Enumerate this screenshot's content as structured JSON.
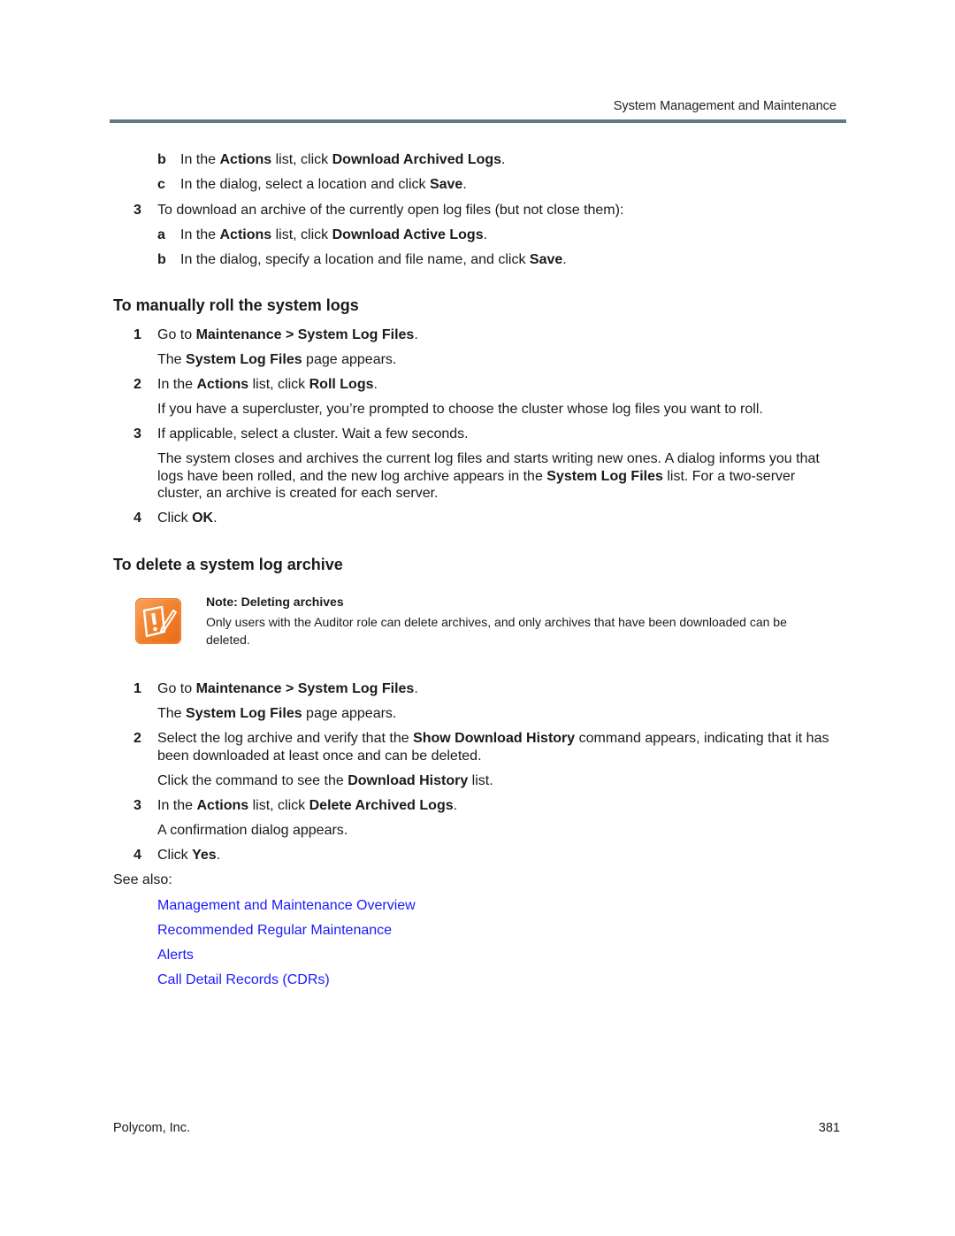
{
  "header": {
    "running_title": "System Management and Maintenance"
  },
  "top_steps": {
    "b1": {
      "marker": "b",
      "pre": "In the ",
      "b1": "Actions",
      "mid": " list, click ",
      "b2": "Download Archived Logs",
      "post": "."
    },
    "c1": {
      "marker": "c",
      "pre": "In the dialog, select a location and click ",
      "b1": "Save",
      "post": "."
    },
    "s3": {
      "marker": "3",
      "text": "To download an archive of the currently open log files (but not close them):"
    },
    "a2": {
      "marker": "a",
      "pre": "In the ",
      "b1": "Actions",
      "mid": " list, click ",
      "b2": "Download Active Logs",
      "post": "."
    },
    "b2": {
      "marker": "b",
      "pre": "In the dialog, specify a location and file name, and click ",
      "b1": "Save",
      "post": "."
    }
  },
  "roll_section": {
    "heading": "To manually roll the system logs",
    "step1": {
      "marker": "1",
      "pre": "Go to ",
      "b1": "Maintenance > System Log Files",
      "post": "."
    },
    "step1_result": {
      "pre": "The ",
      "b1": "System Log Files",
      "post": " page appears."
    },
    "step2": {
      "marker": "2",
      "pre": "In the ",
      "b1": "Actions",
      "mid": " list, click ",
      "b2": "Roll Logs",
      "post": "."
    },
    "step2_result": "If you have a supercluster, you’re prompted to choose the cluster whose log files you want to roll.",
    "step3": {
      "marker": "3",
      "text": "If applicable, select a cluster. Wait a few seconds."
    },
    "step3_result": {
      "pre": "The system closes and archives the current log files and starts writing new ones. A dialog informs you that logs have been rolled, and the new log archive appears in the ",
      "b1": "System Log Files",
      "post": " list. For a two-server cluster, an archive is created for each server."
    },
    "step4": {
      "marker": "4",
      "pre": "Click ",
      "b1": "OK",
      "post": "."
    }
  },
  "delete_section": {
    "heading": "To delete a system log archive",
    "note": {
      "icon": "note-pencil-exclamation-icon",
      "title": "Note: Deleting archives",
      "body": "Only users with the Auditor role can delete archives, and only archives that have been downloaded can be deleted."
    },
    "step1": {
      "marker": "1",
      "pre": "Go to ",
      "b1": "Maintenance > System Log Files",
      "post": "."
    },
    "step1_result": {
      "pre": "The ",
      "b1": "System Log Files",
      "post": " page appears."
    },
    "step2": {
      "marker": "2",
      "pre": "Select the log archive and verify that the ",
      "b1": "Show Download History",
      "post": " command appears, indicating that it has been downloaded at least once and can be deleted."
    },
    "step2_result": {
      "pre": "Click the command to see the ",
      "b1": "Download History",
      "post": " list."
    },
    "step3": {
      "marker": "3",
      "pre": "In the ",
      "b1": "Actions",
      "mid": " list, click ",
      "b2": "Delete Archived Logs",
      "post": "."
    },
    "step3_result": "A confirmation dialog appears.",
    "step4": {
      "marker": "4",
      "pre": "Click ",
      "b1": "Yes",
      "post": "."
    }
  },
  "see_also": {
    "label": "See also:",
    "links": [
      "Management and Maintenance Overview",
      "Recommended Regular Maintenance",
      "Alerts",
      "Call Detail Records (CDRs)"
    ],
    "link_color": "#1a1aff"
  },
  "footer": {
    "company": "Polycom, Inc.",
    "page_number": "381"
  },
  "colors": {
    "header_rule": "#5f7a83",
    "note_icon": "#f07f2a"
  }
}
